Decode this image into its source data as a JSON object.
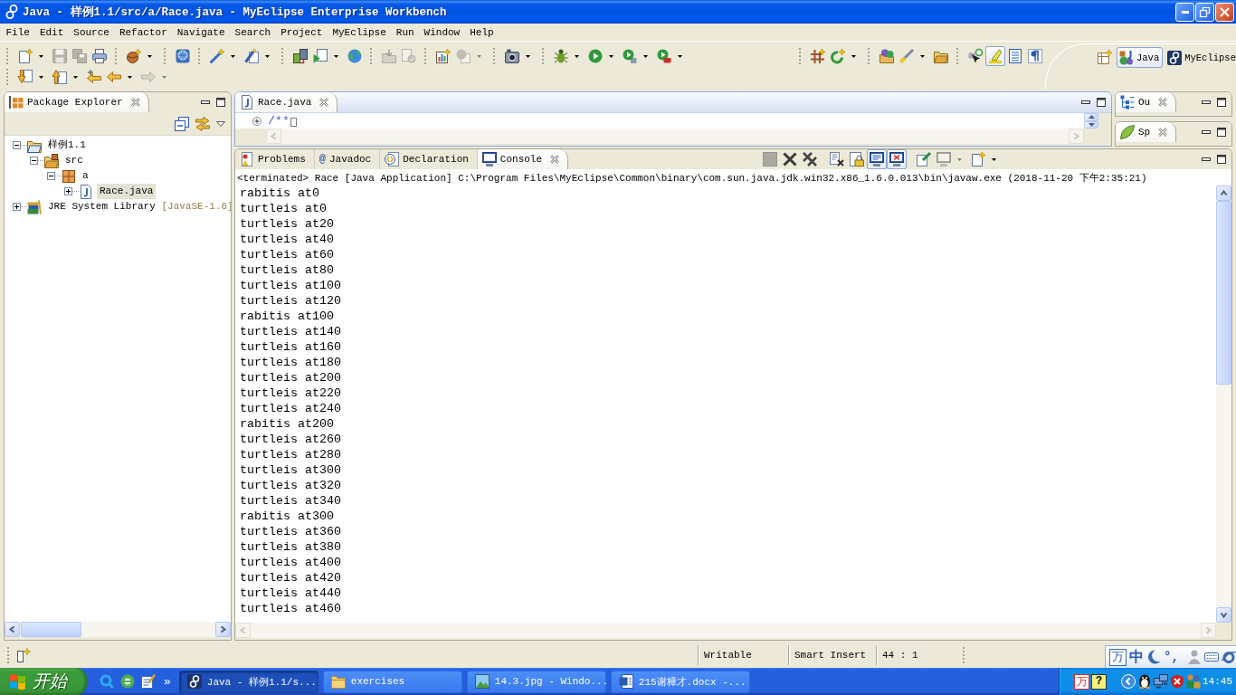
{
  "window": {
    "title": "Java - 样例1.1/src/a/Race.java - MyEclipse Enterprise Workbench"
  },
  "menu": [
    "File",
    "Edit",
    "Source",
    "Refactor",
    "Navigate",
    "Search",
    "Project",
    "MyEclipse",
    "Run",
    "Window",
    "Help"
  ],
  "toolbar": {
    "main": [
      [
        {
          "kind": "new",
          "dropdown": true,
          "disabled": false,
          "pressed": false
        },
        {
          "kind": "save",
          "dropdown": false,
          "disabled": true,
          "pressed": false
        },
        {
          "kind": "save_all",
          "dropdown": false,
          "disabled": true,
          "pressed": false
        },
        {
          "kind": "print",
          "dropdown": false,
          "disabled": false,
          "pressed": false
        }
      ],
      [
        {
          "kind": "new_class",
          "dropdown": true,
          "disabled": false,
          "pressed": false
        }
      ],
      [
        {
          "kind": "web20",
          "dropdown": false,
          "disabled": false,
          "pressed": false
        }
      ],
      [
        {
          "kind": "wand",
          "dropdown": true,
          "disabled": false,
          "pressed": false
        },
        {
          "kind": "pen_page",
          "dropdown": true,
          "disabled": false,
          "pressed": false
        }
      ],
      [
        {
          "kind": "deploy",
          "dropdown": false,
          "disabled": false,
          "pressed": false
        },
        {
          "kind": "page_play",
          "dropdown": true,
          "disabled": false,
          "pressed": false
        },
        {
          "kind": "globe",
          "dropdown": false,
          "disabled": false,
          "pressed": false
        }
      ],
      [
        {
          "kind": "folder_grey",
          "dropdown": false,
          "disabled": true,
          "pressed": false
        },
        {
          "kind": "page_refresh",
          "dropdown": false,
          "disabled": true,
          "pressed": false
        }
      ],
      [
        {
          "kind": "table_sparkle",
          "dropdown": false,
          "disabled": false,
          "pressed": false
        },
        {
          "kind": "globe_page",
          "dropdown": true,
          "disabled": true,
          "pressed": false
        }
      ],
      [
        {
          "kind": "camera",
          "dropdown": true,
          "disabled": false,
          "pressed": false
        }
      ],
      [
        {
          "kind": "bug",
          "dropdown": true,
          "disabled": false,
          "pressed": false
        },
        {
          "kind": "run",
          "dropdown": true,
          "disabled": false,
          "pressed": false
        },
        {
          "kind": "run_list",
          "dropdown": true,
          "disabled": false,
          "pressed": false
        },
        {
          "kind": "run_toolbox",
          "dropdown": true,
          "disabled": false,
          "pressed": false
        }
      ]
    ],
    "extra": [
      [
        {
          "kind": "grid_sparkle",
          "dropdown": false,
          "disabled": false,
          "pressed": false
        },
        {
          "kind": "refresh_sparkle",
          "dropdown": true,
          "disabled": false,
          "pressed": false
        }
      ],
      [
        {
          "kind": "folder_spheres",
          "dropdown": false,
          "disabled": false,
          "pressed": false
        },
        {
          "kind": "brush",
          "dropdown": true,
          "disabled": false,
          "pressed": false
        },
        {
          "kind": "folder_open",
          "dropdown": false,
          "disabled": false,
          "pressed": false
        }
      ],
      [
        {
          "kind": "cursor_badge",
          "dropdown": false,
          "disabled": false,
          "pressed": false
        },
        {
          "kind": "highlighter",
          "dropdown": false,
          "disabled": false,
          "pressed": true
        },
        {
          "kind": "doc_lines",
          "dropdown": false,
          "disabled": false,
          "pressed": false
        },
        {
          "kind": "pilcrow",
          "dropdown": false,
          "disabled": false,
          "pressed": false
        }
      ]
    ],
    "second_row": [
      [
        {
          "kind": "down_list",
          "dropdown": true,
          "disabled": false,
          "pressed": false
        },
        {
          "kind": "up_list",
          "dropdown": true,
          "disabled": false,
          "pressed": false
        },
        {
          "kind": "back_star",
          "dropdown": false,
          "disabled": false,
          "pressed": false
        },
        {
          "kind": "back",
          "dropdown": true,
          "disabled": false,
          "pressed": false
        },
        {
          "kind": "forward",
          "dropdown": true,
          "disabled": true,
          "pressed": false
        }
      ]
    ]
  },
  "perspectives": [
    {
      "label": "Java",
      "kind": "java",
      "selected": true
    },
    {
      "label": "MyEclipse",
      "kind": "myeclipse",
      "selected": false
    }
  ],
  "package_explorer": {
    "tabs": [
      {
        "label": "Package Explorer",
        "kind": "package_explorer",
        "selected": true
      }
    ],
    "tree": [
      {
        "label": "样例1.1",
        "kind": "project",
        "expanded": true,
        "selected": false,
        "children": [
          {
            "label": "src",
            "kind": "source_folder",
            "expanded": true,
            "selected": false,
            "children": [
              {
                "label": "a",
                "kind": "package",
                "expanded": true,
                "selected": false,
                "children": [
                  {
                    "label": "Race.java",
                    "kind": "java_file",
                    "expanded": false,
                    "selected": true
                  }
                ]
              }
            ]
          }
        ]
      },
      {
        "label": "JRE System Library",
        "suffix": "[JavaSE-1.6]",
        "kind": "library",
        "expanded": false,
        "selected": false
      }
    ]
  },
  "editor": {
    "tabs": [
      {
        "label": "Race.java",
        "kind": "java_file",
        "selected": true
      }
    ],
    "lines": [
      {
        "text": "/**",
        "folded": true
      }
    ]
  },
  "side_views": [
    {
      "tabs": [
        {
          "label": "Ou",
          "kind": "outline",
          "selected": true
        }
      ]
    },
    {
      "tabs": [
        {
          "label": "Sp",
          "kind": "leaf",
          "selected": true
        }
      ]
    }
  ],
  "console": {
    "tabs": [
      {
        "label": "Problems",
        "kind": "problems",
        "selected": false
      },
      {
        "label": "Javadoc",
        "kind": "javadoc",
        "glyph": "@",
        "selected": false
      },
      {
        "label": "Declaration",
        "kind": "declaration",
        "selected": false
      },
      {
        "label": "Console",
        "kind": "console",
        "selected": true
      }
    ],
    "toolbar": [
      [
        {
          "kind": "terminate",
          "dropdown": false,
          "disabled": true,
          "pressed": false
        },
        {
          "kind": "remove_launch",
          "dropdown": false,
          "disabled": false,
          "pressed": false
        },
        {
          "kind": "remove_all",
          "dropdown": false,
          "disabled": false,
          "pressed": false
        }
      ],
      [
        {
          "kind": "clear",
          "dropdown": false,
          "disabled": false,
          "pressed": false
        },
        {
          "kind": "scroll_lock",
          "dropdown": false,
          "disabled": false,
          "pressed": false
        },
        {
          "kind": "show_out",
          "dropdown": false,
          "disabled": false,
          "pressed": true
        },
        {
          "kind": "show_err",
          "dropdown": false,
          "disabled": false,
          "pressed": true
        }
      ],
      [
        {
          "kind": "pin",
          "dropdown": false,
          "disabled": false,
          "pressed": false
        },
        {
          "kind": "display",
          "dropdown": true,
          "disabled": true,
          "pressed": false
        },
        {
          "kind": "open_console",
          "dropdown": true,
          "disabled": false,
          "pressed": false
        }
      ]
    ],
    "process": "<terminated> Race [Java Application] C:\\Program Files\\MyEclipse\\Common\\binary\\com.sun.java.jdk.win32.x86_1.6.0.013\\bin\\javaw.exe (2018-11-20 下午2:35:21)",
    "output": [
      "rabitis at0",
      "turtleis at0",
      "turtleis at20",
      "turtleis at40",
      "turtleis at60",
      "turtleis at80",
      "turtleis at100",
      "turtleis at120",
      "rabitis at100",
      "turtleis at140",
      "turtleis at160",
      "turtleis at180",
      "turtleis at200",
      "turtleis at220",
      "turtleis at240",
      "rabitis at200",
      "turtleis at260",
      "turtleis at280",
      "turtleis at300",
      "turtleis at320",
      "turtleis at340",
      "rabitis at300",
      "turtleis at360",
      "turtleis at380",
      "turtleis at400",
      "turtleis at420",
      "turtleis at440",
      "turtleis at460"
    ]
  },
  "status_bar": {
    "fields": [
      "Writable",
      "Smart Insert",
      "44 : 1"
    ]
  },
  "ime_bar": {
    "logo": "万",
    "mode": "中",
    "punctuation": "°,"
  },
  "taskbar": {
    "start": "开始",
    "quick_launch": [
      {
        "kind": "ring"
      },
      {
        "kind": "disc"
      },
      {
        "kind": "notepad"
      }
    ],
    "more": "»",
    "tasks": [
      {
        "label": "Java - 样例1.1/s...",
        "kind": "eclipse",
        "selected": true
      },
      {
        "label": "exercises",
        "kind": "folder",
        "selected": false
      },
      {
        "label": "14.3.jpg - Windo...",
        "kind": "image",
        "selected": false
      },
      {
        "label": "215谢樟才.docx -...",
        "kind": "word",
        "selected": false
      }
    ],
    "tray": [
      {
        "kind": "ime",
        "glyph": "万"
      },
      {
        "kind": "help",
        "glyph": "?"
      },
      {
        "kind": "chevron"
      },
      {
        "kind": "penguin"
      },
      {
        "kind": "monitors"
      },
      {
        "kind": "shield"
      },
      {
        "kind": "people"
      }
    ],
    "clock": "14:45"
  }
}
